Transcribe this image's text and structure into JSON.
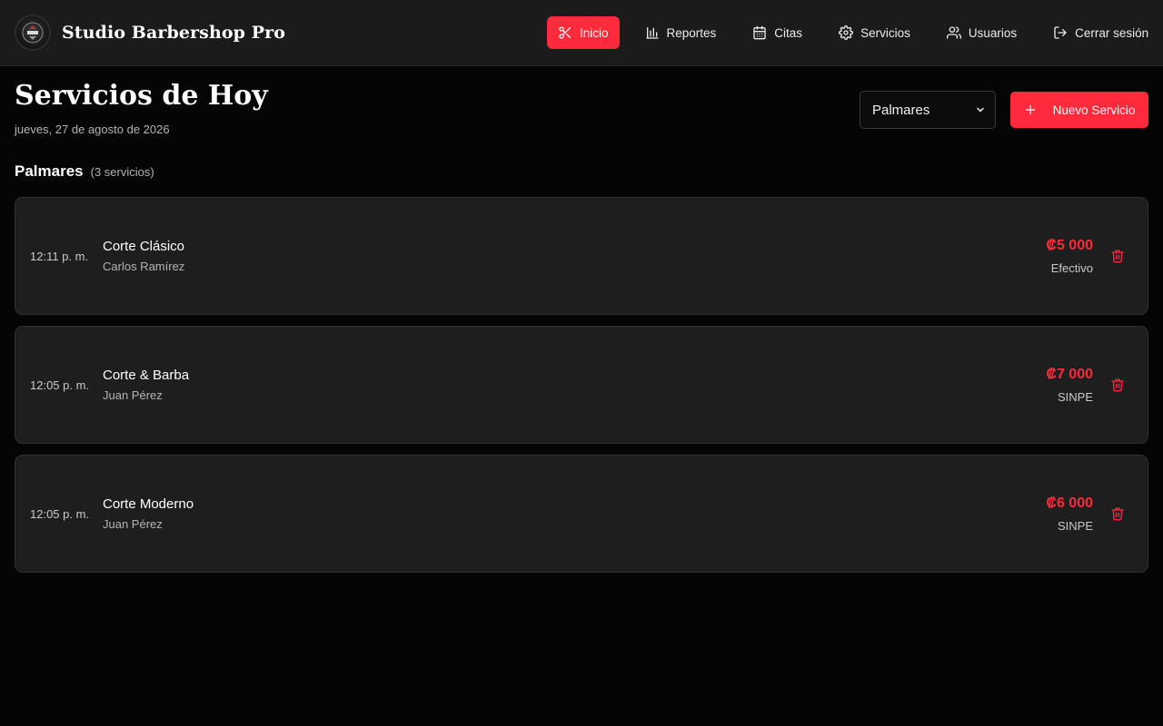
{
  "app": {
    "title": "Studio Barbershop Pro"
  },
  "nav": {
    "items": [
      {
        "label": "Inicio",
        "icon": "scissors-icon",
        "active": true
      },
      {
        "label": "Reportes",
        "icon": "bar-chart-icon"
      },
      {
        "label": "Citas",
        "icon": "calendar-icon"
      },
      {
        "label": "Servicios",
        "icon": "gear-icon"
      },
      {
        "label": "Usuarios",
        "icon": "users-icon"
      },
      {
        "label": "Cerrar sesión",
        "icon": "logout-icon"
      }
    ]
  },
  "page": {
    "title": "Servicios de Hoy",
    "date": "jueves, 27 de agosto de 2026"
  },
  "controls": {
    "branch_select_value": "Palmares",
    "new_service_label": "Nuevo Servicio"
  },
  "section": {
    "title": "Palmares",
    "count": "(3 servicios)"
  },
  "services": [
    {
      "time": "12:11 p. m.",
      "service": "Corte Clásico",
      "barber": "Carlos Ramírez",
      "price": "₡5 000",
      "method": "Efectivo"
    },
    {
      "time": "12:05 p. m.",
      "service": "Corte & Barba",
      "barber": "Juan Pérez",
      "price": "₡7 000",
      "method": "SINPE"
    },
    {
      "time": "12:05 p. m.",
      "service": "Corte Moderno",
      "barber": "Juan Pérez",
      "price": "₡6 000",
      "method": "SINPE"
    }
  ],
  "colors": {
    "accent": "#ff2a3b",
    "background": "#050505",
    "header": "#1b1b1b",
    "card": "#1e1e1e"
  }
}
